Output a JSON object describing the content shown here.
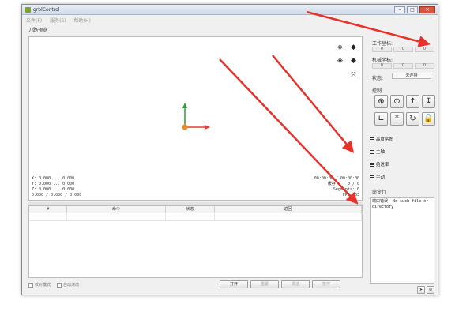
{
  "window": {
    "title": "grblControl",
    "minimize": "–",
    "maximize": "□",
    "close": "✕"
  },
  "menu": [
    "文件(F)",
    "服务(S)",
    "帮助(H)"
  ],
  "view": {
    "label": "刀路预览",
    "cube_icons": [
      "iso-view-icon",
      "top-view-icon",
      "front-view-icon",
      "left-view-icon",
      "fit-view-icon"
    ],
    "coords": "X: 0.000 ... 0.000\nY: 0.000 ... 0.000\nZ: 0.000 ... 0.000\n0.000 / 0.000 / 0.000",
    "stats": "00:00:00 / 00:00:00\n缓存:    0 / 0\nSegments: 0\nFPS: 63"
  },
  "table": {
    "columns": [
      "#",
      "命令",
      "状态",
      "返回"
    ]
  },
  "bottom": {
    "check_mode": "校对模式",
    "autoscroll": "自动滚动",
    "open": "打开",
    "reset": "重置",
    "send": "发送",
    "pause": "暂停"
  },
  "right": {
    "work_coords_label": "工作坐标:",
    "work_coords": [
      "0",
      "0",
      "0"
    ],
    "machine_coords_label": "机械坐标:",
    "machine_coords": [
      "0",
      "0",
      "0"
    ],
    "state_label": "状态:",
    "state_value": "未连接",
    "control_label": "控制",
    "sections": [
      "高度贴图",
      "主轴",
      "给进率",
      "手动"
    ],
    "console_label": "命令行",
    "console_text": "端口错误: No such file or\ndirectory"
  },
  "colors": {
    "arrow": "#e8312a",
    "axis_x": "#e53935",
    "axis_y": "#2e9e2e",
    "origin": "#f08a24"
  }
}
